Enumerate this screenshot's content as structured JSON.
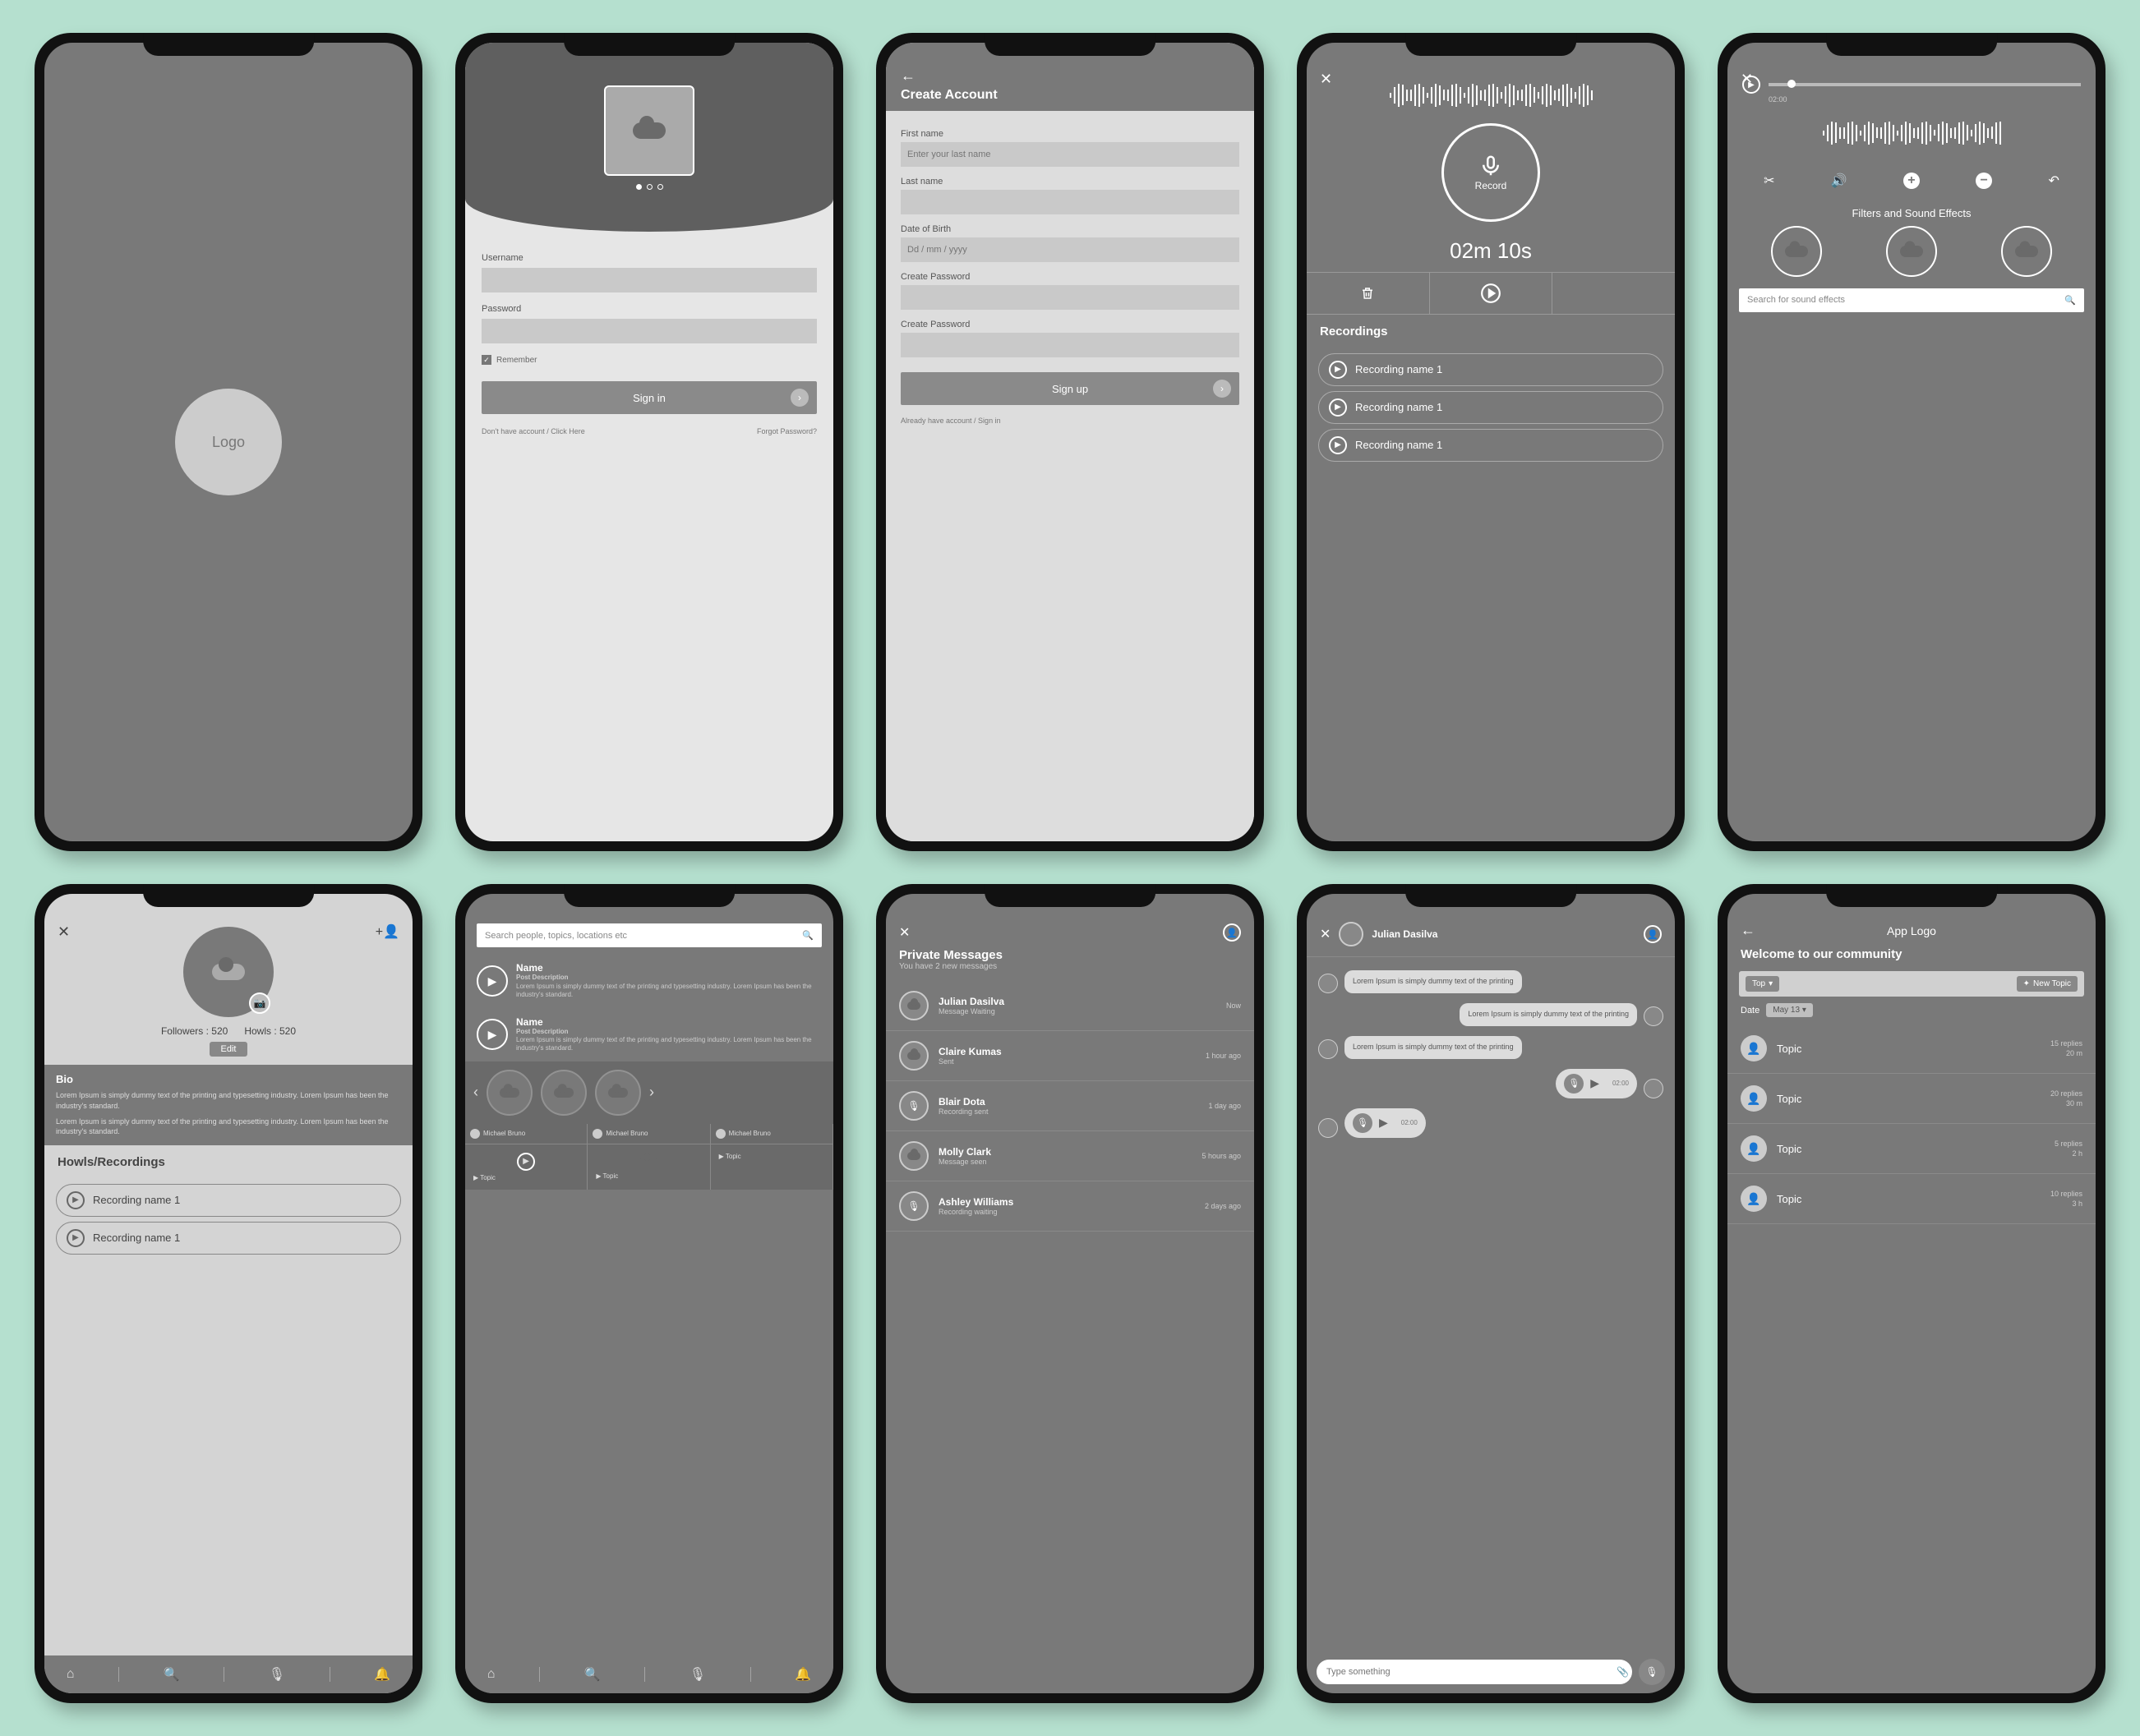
{
  "s1": {
    "logo": "Logo"
  },
  "s2": {
    "username": "Username",
    "password": "Password",
    "remember": "Remember",
    "signin": "Sign in",
    "noacct": "Don't have account / Click Here",
    "forgot": "Forgot Password?"
  },
  "s3": {
    "title": "Create Account",
    "firstname": "First name",
    "firstname_ph": "Enter your last name",
    "lastname": "Last name",
    "dob": "Date of Birth",
    "dob_ph": "Dd / mm / yyyy",
    "createpw": "Create Password",
    "signup": "Sign up",
    "already": "Already have account / Sign in"
  },
  "s4": {
    "record": "Record",
    "timer": "02m 10s",
    "recordings": "Recordings",
    "items": [
      "Recording name 1",
      "Recording name 1",
      "Recording name 1"
    ]
  },
  "s5": {
    "dur": "02:00",
    "filters": "Filters and Sound Effects",
    "search_ph": "Search for sound effects"
  },
  "s6": {
    "followers": "Followers : 520",
    "howls": "Howls : 520",
    "edit": "Edit",
    "bio": "Bio",
    "bio_p1": "Lorem Ipsum is simply dummy text of the printing and typesetting industry.  Lorem Ipsum has been the industry's standard.",
    "bio_p2": "Lorem Ipsum is simply dummy text of the printing and typesetting industry.  Lorem Ipsum has been the industry's standard.",
    "section": "Howls/Recordings",
    "recs": [
      "Recording name 1",
      "Recording name 1"
    ]
  },
  "s7": {
    "search_ph": "Search people, topics, locations etc",
    "posts": [
      {
        "name": "Name",
        "sub": "Post Description",
        "body": "Lorem Ipsum is simply dummy text of the printing and typesetting industry. Lorem Ipsum has been the industry's standard."
      },
      {
        "name": "Name",
        "sub": "Post Description",
        "body": "Lorem Ipsum is simply dummy text of the printing and typesetting industry. Lorem Ipsum has been the industry's standard."
      }
    ],
    "mini": [
      "Michael Bruno",
      "Michael Bruno",
      "Michael Bruno"
    ],
    "topic": "Topic"
  },
  "s8": {
    "title": "Private Messages",
    "sub": "You have 2 new messages",
    "items": [
      {
        "name": "Julian Dasilva",
        "sub": "Message Waiting",
        "time": "Now",
        "icon": "cloud"
      },
      {
        "name": "Claire Kumas",
        "sub": "Sent",
        "time": "1 hour ago",
        "icon": "cloud"
      },
      {
        "name": "Blair Dota",
        "sub": "Recording sent",
        "time": "1 day ago",
        "icon": "mic"
      },
      {
        "name": "Molly Clark",
        "sub": "Message seen",
        "time": "5 hours ago",
        "icon": "cloud"
      },
      {
        "name": "Ashley Williams",
        "sub": "Recording waiting",
        "time": "2 days ago",
        "icon": "mic"
      }
    ]
  },
  "s9": {
    "name": "Julian Dasilva",
    "msgs": [
      "Lorem Ipsum is simply dummy text of the printing",
      "Lorem Ipsum is simply dummy text of the printing",
      "Lorem Ipsum is simply dummy text of the printing"
    ],
    "dur": "02:00",
    "input_ph": "Type something"
  },
  "s10": {
    "logo": "App Logo",
    "welcome": "Welcome to our community",
    "top": "Top",
    "new": "New Topic",
    "date": "Date",
    "dateval": "May 13",
    "topics": [
      {
        "t": "Topic",
        "r": "15 replies",
        "d": "20 m"
      },
      {
        "t": "Topic",
        "r": "20 replies",
        "d": "30 m"
      },
      {
        "t": "Topic",
        "r": "5 replies",
        "d": "2 h"
      },
      {
        "t": "Topic",
        "r": "10 replies",
        "d": "3 h"
      }
    ]
  }
}
